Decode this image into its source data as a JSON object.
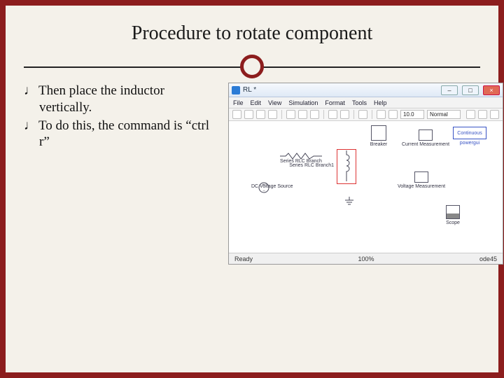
{
  "slide": {
    "title": "Procedure to rotate component",
    "bullets": [
      "Then place the inductor vertically.",
      "To do this, the command is “ctrl r”"
    ],
    "dingbat": "♩"
  },
  "window": {
    "title": "RL *",
    "buttons": {
      "min": "–",
      "max": "□",
      "close": "×"
    },
    "menu": [
      "File",
      "Edit",
      "View",
      "Simulation",
      "Format",
      "Tools",
      "Help"
    ],
    "toolbar": {
      "time": "10.0",
      "mode": "Normal"
    },
    "status": {
      "left": "Ready",
      "mid": "100%",
      "right": "ode45"
    }
  },
  "blocks": {
    "breaker": "Breaker",
    "current": "Current Measurement",
    "powergui": "Continuous",
    "powergui_lbl": "powergui",
    "rlc": "Series RLC Branch",
    "rlc1": "Series RLC Branch1",
    "dcsrc": "DC Voltage Source",
    "vmeas": "Voltage Measurement",
    "scope": "Scope"
  }
}
